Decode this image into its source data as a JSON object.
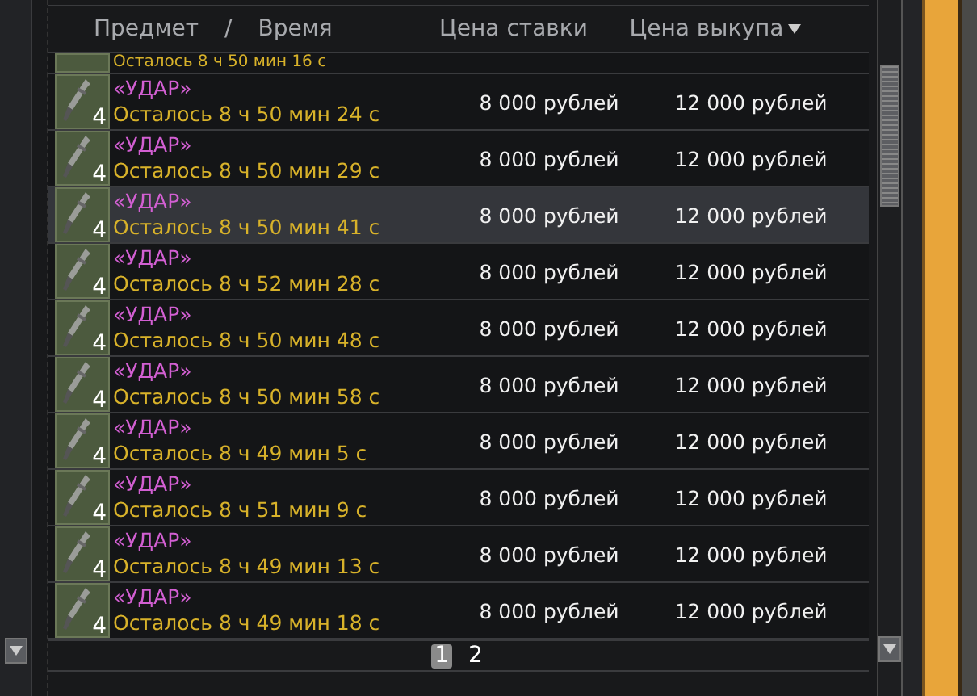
{
  "columns": [
    {
      "label": "Предмет"
    },
    {
      "label": "/"
    },
    {
      "label": "Время"
    },
    {
      "label": "Цена ставки",
      "sorted": false
    },
    {
      "label": "Цена выкупа",
      "sorted": true
    }
  ],
  "rows": [
    {
      "kind": "partial",
      "time": "Осталось 8 ч 50 мин 16 с",
      "selected": false
    },
    {
      "kind": "full",
      "count": "4",
      "name": "«УДАР»",
      "time": "Осталось 8 ч 50 мин 24 с",
      "bid": "8 000 рублей",
      "buyout": "12 000 рублей",
      "selected": false
    },
    {
      "kind": "full",
      "count": "4",
      "name": "«УДАР»",
      "time": "Осталось 8 ч 50 мин 29 с",
      "bid": "8 000 рублей",
      "buyout": "12 000 рублей",
      "selected": false
    },
    {
      "kind": "full",
      "count": "4",
      "name": "«УДАР»",
      "time": "Осталось 8 ч 50 мин 41 с",
      "bid": "8 000 рублей",
      "buyout": "12 000 рублей",
      "selected": true
    },
    {
      "kind": "full",
      "count": "4",
      "name": "«УДАР»",
      "time": "Осталось 8 ч 52 мин 28 с",
      "bid": "8 000 рублей",
      "buyout": "12 000 рублей",
      "selected": false
    },
    {
      "kind": "full",
      "count": "4",
      "name": "«УДАР»",
      "time": "Осталось 8 ч 50 мин 48 с",
      "bid": "8 000 рублей",
      "buyout": "12 000 рублей",
      "selected": false
    },
    {
      "kind": "full",
      "count": "4",
      "name": "«УДАР»",
      "time": "Осталось 8 ч 50 мин 58 с",
      "bid": "8 000 рублей",
      "buyout": "12 000 рублей",
      "selected": false
    },
    {
      "kind": "full",
      "count": "4",
      "name": "«УДАР»",
      "time": "Осталось 8 ч 49 мин 5 с",
      "bid": "8 000 рублей",
      "buyout": "12 000 рублей",
      "selected": false
    },
    {
      "kind": "full",
      "count": "4",
      "name": "«УДАР»",
      "time": "Осталось 8 ч 51 мин 9 с",
      "bid": "8 000 рублей",
      "buyout": "12 000 рублей",
      "selected": false
    },
    {
      "kind": "full",
      "count": "4",
      "name": "«УДАР»",
      "time": "Осталось 8 ч 49 мин 13 с",
      "bid": "8 000 рублей",
      "buyout": "12 000 рублей",
      "selected": false
    },
    {
      "kind": "full",
      "count": "4",
      "name": "«УДАР»",
      "time": "Осталось 8 ч 49 мин 18 с",
      "bid": "8 000 рублей",
      "buyout": "12 000 рублей",
      "selected": false
    }
  ],
  "pages": [
    {
      "label": "1",
      "selected": true
    },
    {
      "label": "2",
      "selected": false
    }
  ]
}
